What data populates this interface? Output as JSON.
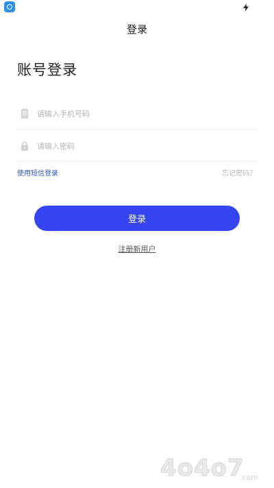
{
  "nav": {
    "title": "登录"
  },
  "page": {
    "title": "账号登录"
  },
  "form": {
    "phone": {
      "placeholder": "请输入手机号码",
      "value": ""
    },
    "password": {
      "placeholder": "请输入密码",
      "value": ""
    }
  },
  "links": {
    "sms_login": "使用短信登录",
    "forgot_password": "忘记密码？",
    "register": "注册新用户"
  },
  "buttons": {
    "login": "登录"
  },
  "watermark": {
    "text": "4o4o7",
    "domain": ".com"
  },
  "colors": {
    "primary": "#3545f2",
    "link": "#2f56c9",
    "placeholder": "#b4b4b4",
    "app_icon": "#2f8fe6"
  },
  "icons": {
    "status_app": "app-icon",
    "status_charge": "lightning-icon",
    "phone_field": "phone-icon",
    "password_field": "lock-icon"
  }
}
